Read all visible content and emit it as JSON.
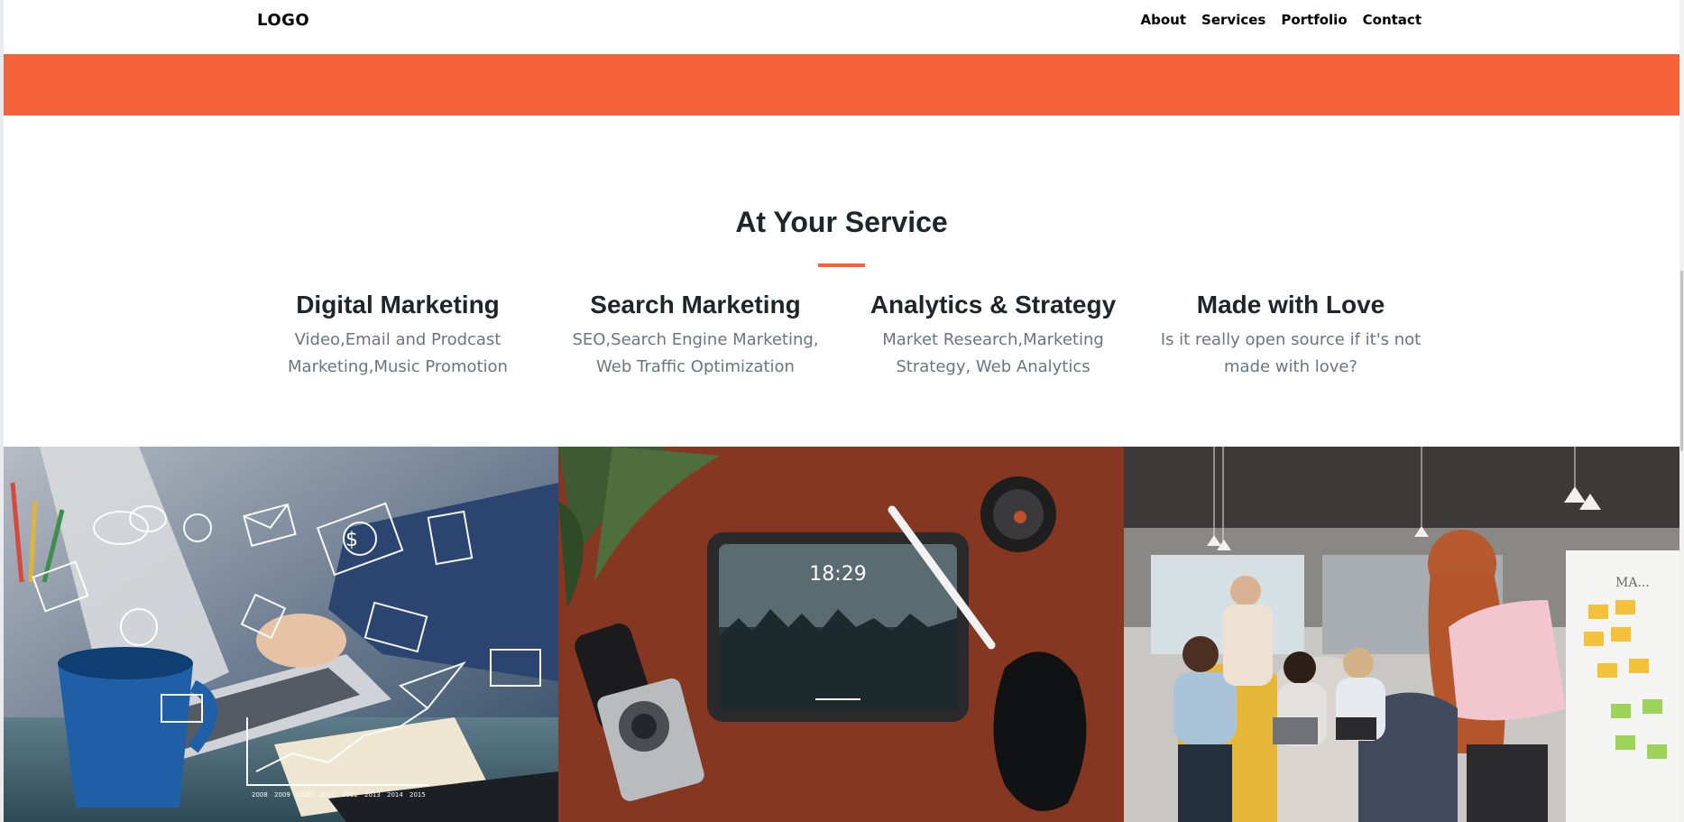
{
  "navbar": {
    "logo": "LOGO",
    "links": [
      {
        "label": "About"
      },
      {
        "label": "Services"
      },
      {
        "label": "Portfolio"
      },
      {
        "label": "Contact"
      }
    ]
  },
  "colors": {
    "accent": "#f4623a",
    "heading": "#212529",
    "muted": "#6c757d"
  },
  "services": {
    "title": "At Your Service",
    "items": [
      {
        "title": "Digital Marketing",
        "desc": "Video,Email and Prodcast Marketing,Music Promotion"
      },
      {
        "title": "Search Marketing",
        "desc": "SEO,Search Engine Marketing, Web Traffic Optimization"
      },
      {
        "title": "Analytics & Strategy",
        "desc": "Market Research,Marketing Strategy, Web Analytics"
      },
      {
        "title": "Made with Love",
        "desc": "Is it really open source if it's not made with love?"
      }
    ]
  },
  "portfolio": {
    "tiles": [
      {
        "subject": "laptop-digital-marketing-icons",
        "chart_years": [
          "2008",
          "2009",
          "2010",
          "2011",
          "2012",
          "2013",
          "2014",
          "2015"
        ]
      },
      {
        "subject": "tablet-desk-flatlay",
        "tablet_time": "18:29"
      },
      {
        "subject": "team-meeting-whiteboard",
        "whiteboard_text": "MA..."
      }
    ]
  }
}
